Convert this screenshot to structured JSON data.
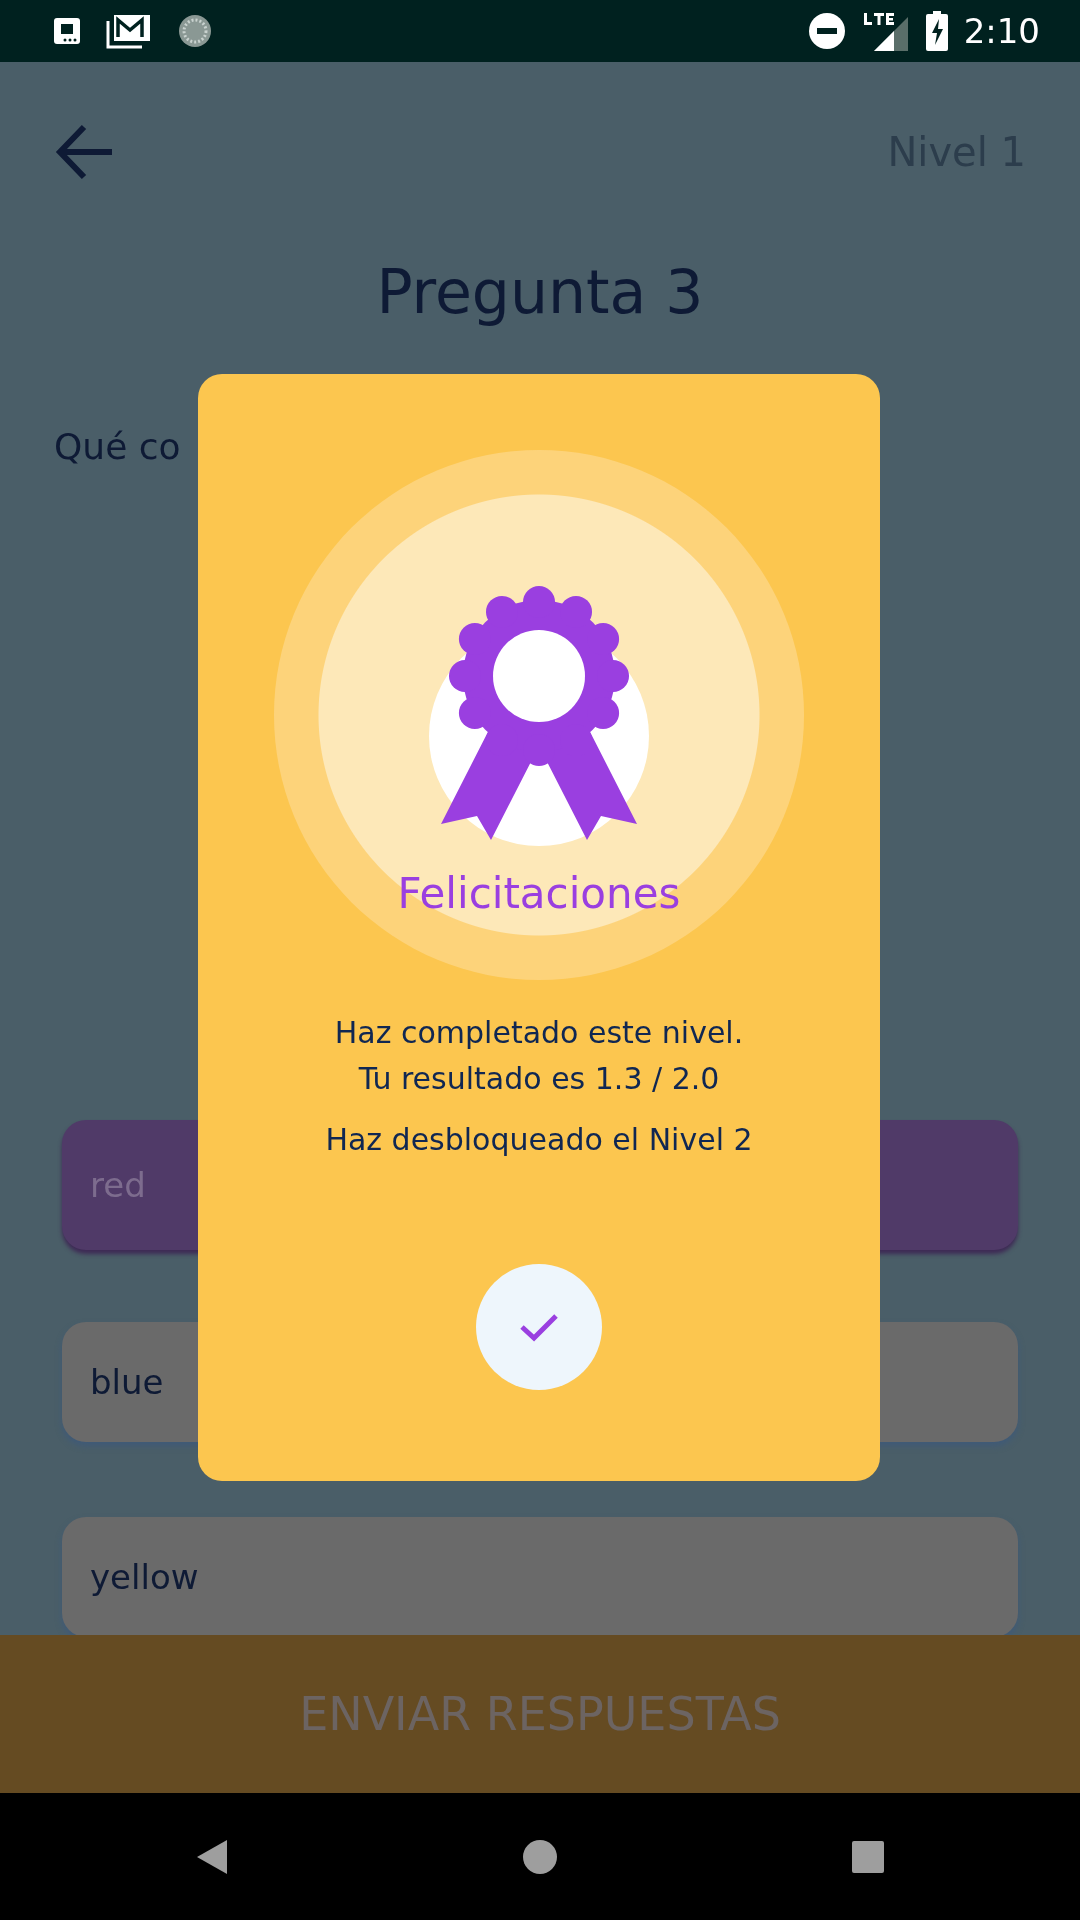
{
  "status_bar": {
    "time": "2:10"
  },
  "header": {
    "level_label": "Nivel 1"
  },
  "title": "Pregunta 3",
  "question": "Qué co",
  "options": [
    {
      "label": "red",
      "selected": true
    },
    {
      "label": "blue",
      "selected": false
    },
    {
      "label": "yellow",
      "selected": false
    }
  ],
  "submit_button": "ENVIAR RESPUESTAS",
  "dialog": {
    "title": "Felicitaciones",
    "message": "Haz completado este nivel.\nTu resultado es 1.3 / 2.0",
    "unlock_message": "Haz desbloqueado el Nivel 2"
  }
}
